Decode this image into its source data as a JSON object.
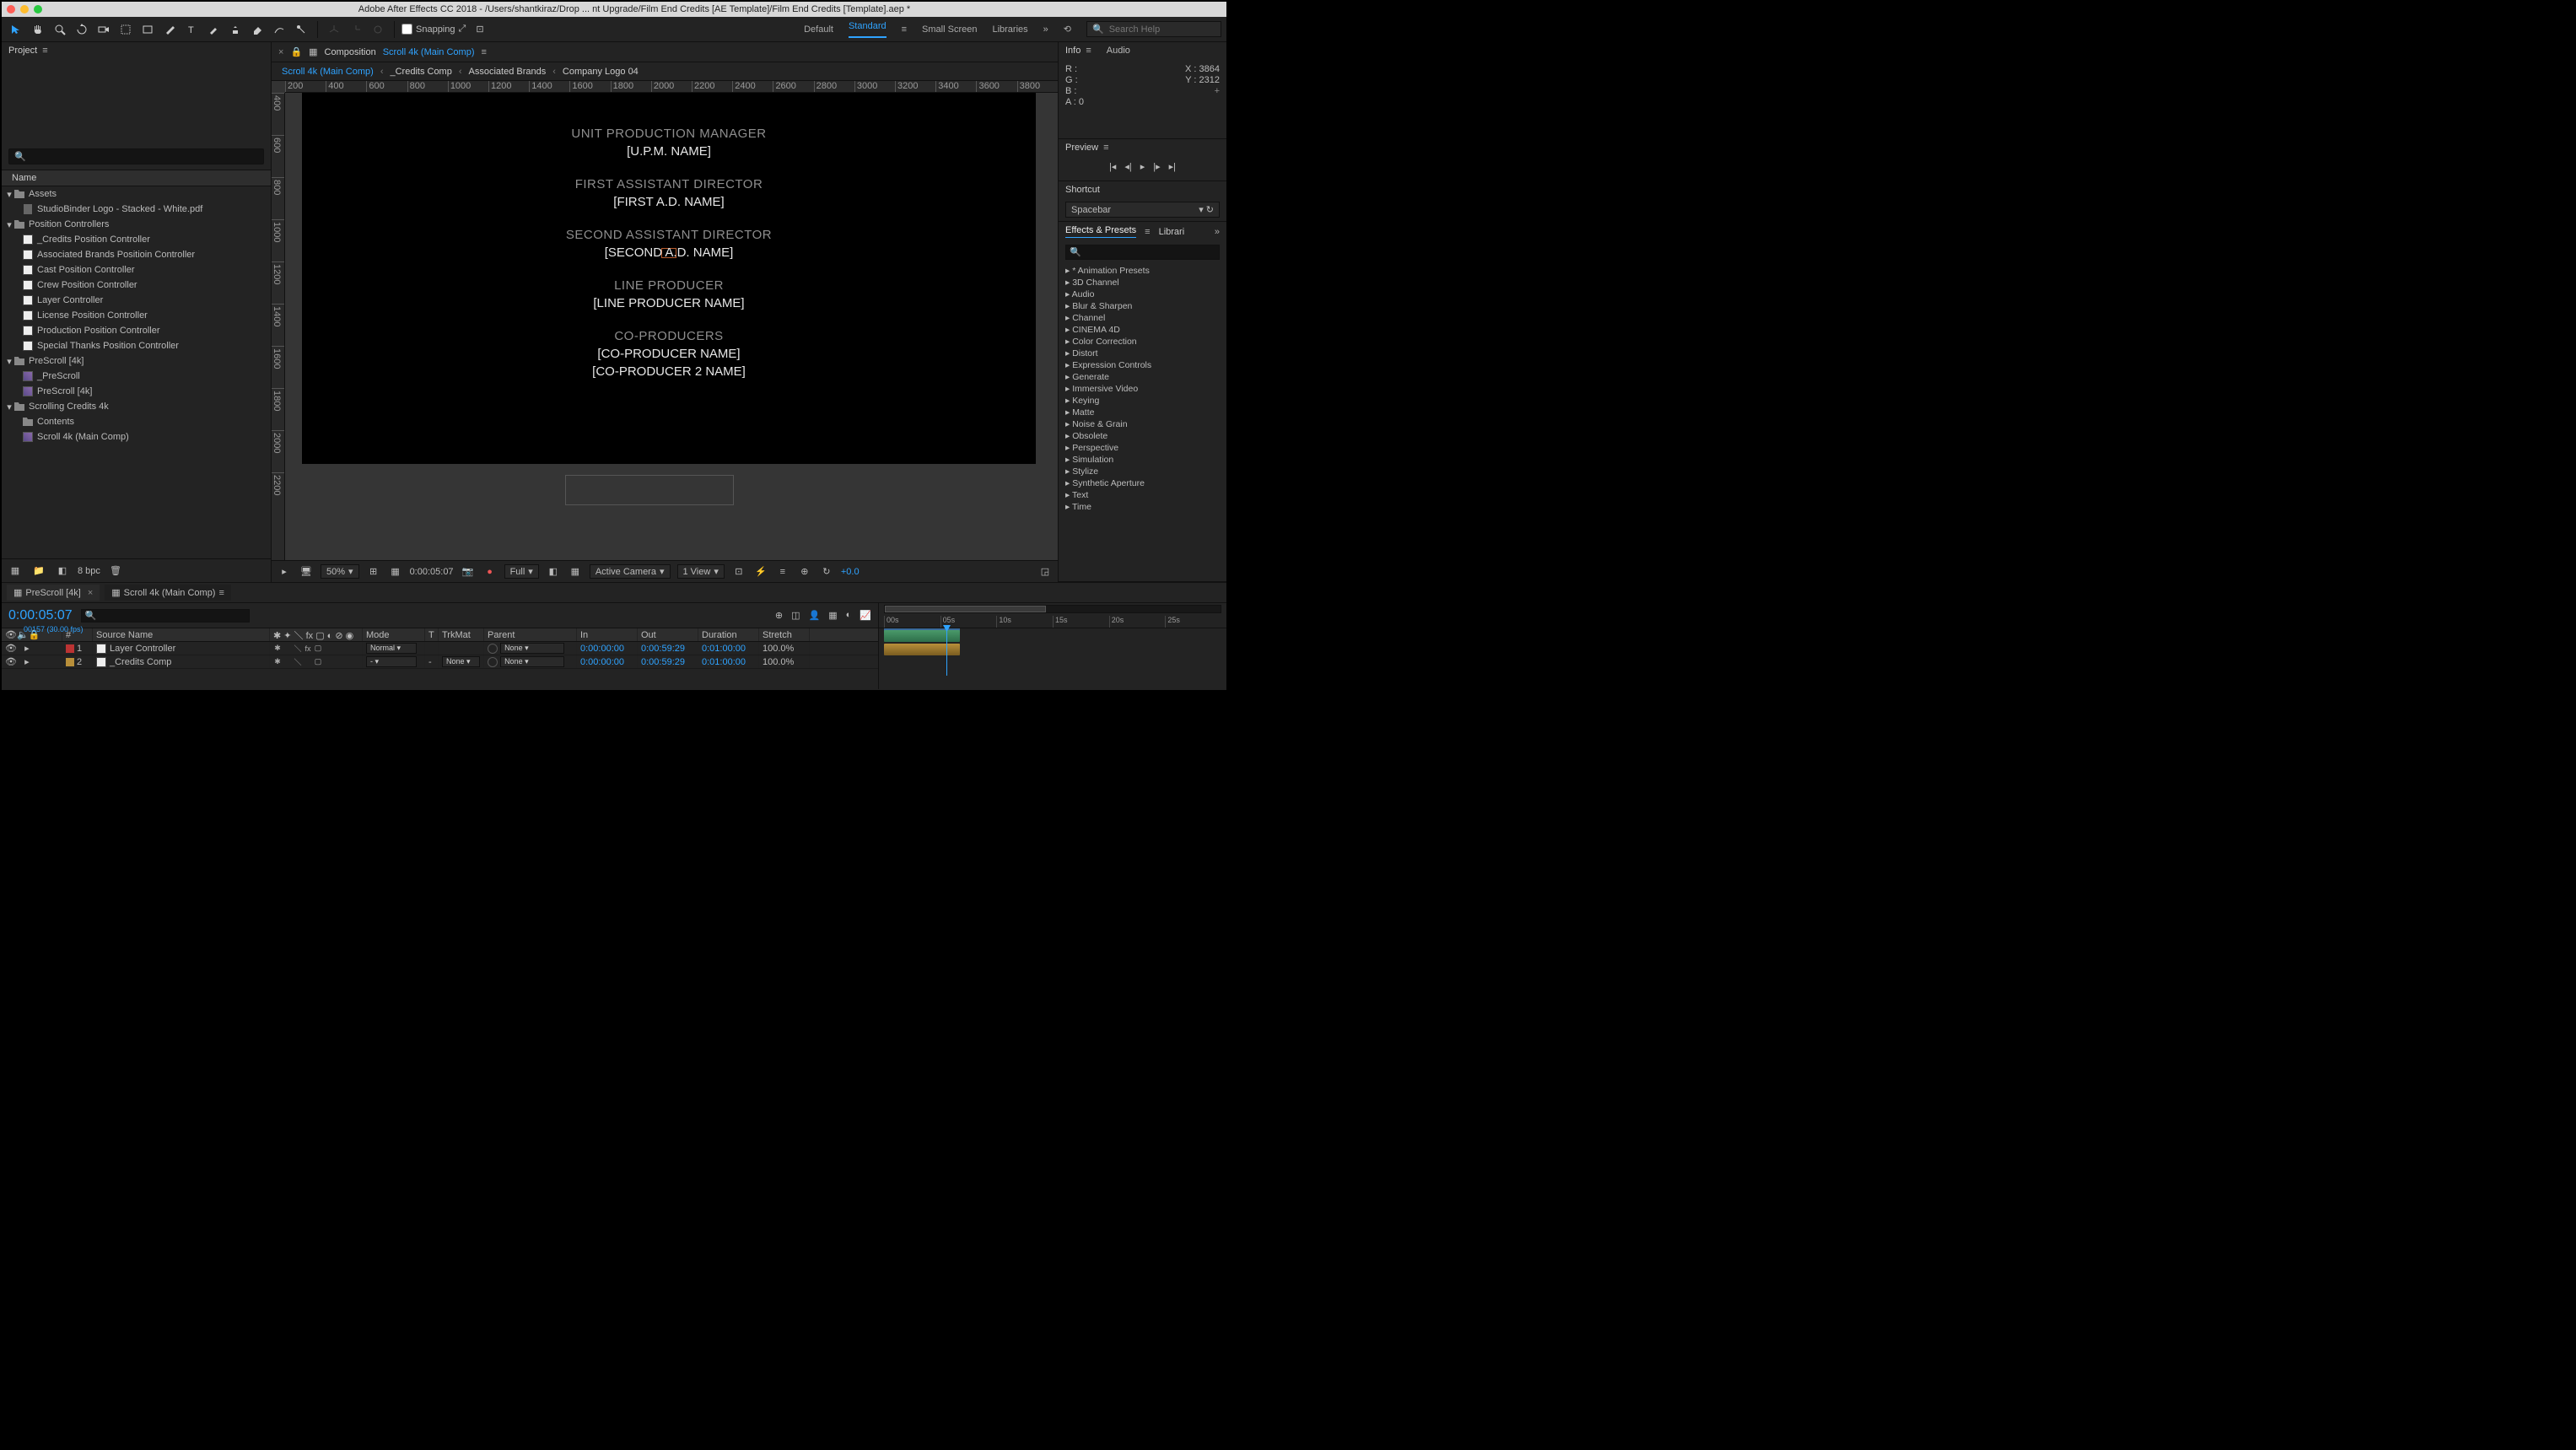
{
  "titlebar": "Adobe After Effects CC 2018 - /Users/shantkiraz/Drop ... nt Upgrade/Film End Credits [AE Template]/Film End Credits [Template].aep *",
  "toolbar": {
    "snapping": "Snapping",
    "workspaces": [
      "Default",
      "Standard",
      "Small Screen",
      "Libraries"
    ],
    "active_workspace": 1,
    "search_placeholder": "Search Help"
  },
  "project_panel": {
    "label": "Project",
    "search_placeholder": "",
    "name_header": "Name",
    "tree": [
      {
        "t": "folder",
        "n": "Assets",
        "open": true,
        "d": 0,
        "children": [
          {
            "t": "file",
            "n": "StudioBinder Logo - Stacked - White.pdf",
            "d": 1
          }
        ]
      },
      {
        "t": "folder",
        "n": "Position Controllers",
        "open": true,
        "d": 0,
        "children": [
          {
            "t": "solid",
            "n": "_Credits Position Controller",
            "d": 1
          },
          {
            "t": "solid",
            "n": "Associated Brands Positioin Controller",
            "d": 1
          },
          {
            "t": "solid",
            "n": "Cast Position Controller",
            "d": 1
          },
          {
            "t": "solid",
            "n": "Crew Position Controller",
            "d": 1
          },
          {
            "t": "solid",
            "n": "Layer Controller",
            "d": 1
          },
          {
            "t": "solid",
            "n": "License Position Controller",
            "d": 1
          },
          {
            "t": "solid",
            "n": "Production Position Controller",
            "d": 1
          },
          {
            "t": "solid",
            "n": "Special Thanks Position Controller",
            "d": 1
          }
        ]
      },
      {
        "t": "folder",
        "n": "PreScroll [4k]",
        "open": true,
        "d": 0,
        "children": [
          {
            "t": "comp",
            "n": "_PreScroll",
            "d": 1
          },
          {
            "t": "comp",
            "n": "PreScroll [4k]",
            "d": 1
          }
        ]
      },
      {
        "t": "folder",
        "n": "Scrolling Credits 4k",
        "open": true,
        "d": 0,
        "children": [
          {
            "t": "folder",
            "n": "Contents",
            "open": false,
            "d": 1
          },
          {
            "t": "comp",
            "n": "Scroll 4k (Main Comp)",
            "d": 1
          }
        ]
      }
    ],
    "footer_bpc": "8 bpc"
  },
  "comp_header": {
    "prefix": "Composition",
    "name": "Scroll 4k (Main Comp)"
  },
  "crumbs": [
    "Scroll 4k (Main Comp)",
    "_Credits Comp",
    "Associated Brands",
    "Company Logo 04"
  ],
  "ruler_h": [
    "200",
    "400",
    "600",
    "800",
    "1000",
    "1200",
    "1400",
    "1600",
    "1800",
    "2000",
    "2200",
    "2400",
    "2600",
    "2800",
    "3000",
    "3200",
    "3400",
    "3600",
    "3800"
  ],
  "ruler_v": [
    "400",
    "600",
    "800",
    "1000",
    "1200",
    "1400",
    "1600",
    "1800",
    "2000",
    "2200"
  ],
  "credits": [
    {
      "role": "UNIT PRODUCTION MANAGER",
      "names": [
        "[U.P.M. NAME]"
      ]
    },
    {
      "role": "FIRST ASSISTANT DIRECTOR",
      "names": [
        "[FIRST A.D. NAME]"
      ]
    },
    {
      "role": "SECOND ASSISTANT DIRECTOR",
      "names": [
        "[SECOND A.D. NAME]"
      ]
    },
    {
      "role": "LINE PRODUCER",
      "names": [
        "[LINE PRODUCER NAME]"
      ]
    },
    {
      "role": "CO-PRODUCERS",
      "names": [
        "[CO-PRODUCER NAME]",
        "[CO-PRODUCER 2 NAME]"
      ]
    }
  ],
  "view_footer": {
    "zoom": "50%",
    "timecode": "0:00:05:07",
    "resolution": "Full",
    "camera": "Active Camera",
    "view": "1 View",
    "exposure": "+0.0"
  },
  "info": {
    "label": "Info",
    "audio_label": "Audio",
    "r": "R :",
    "g": "G :",
    "b": "B :",
    "a": "A :  0",
    "x": "X :  3864",
    "y": "Y :  2312"
  },
  "preview": {
    "label": "Preview"
  },
  "shortcut": {
    "label": "Shortcut",
    "value": "Spacebar"
  },
  "effects": {
    "tab1": "Effects & Presets",
    "tab2": "Librari",
    "items": [
      "* Animation Presets",
      "3D Channel",
      "Audio",
      "Blur & Sharpen",
      "Channel",
      "CINEMA 4D",
      "Color Correction",
      "Distort",
      "Expression Controls",
      "Generate",
      "Immersive Video",
      "Keying",
      "Matte",
      "Noise & Grain",
      "Obsolete",
      "Perspective",
      "Simulation",
      "Stylize",
      "Synthetic Aperture",
      "Text",
      "Time"
    ]
  },
  "timeline": {
    "tabs": [
      "PreScroll [4k]",
      "Scroll 4k (Main Comp)"
    ],
    "active_tab": 1,
    "timecode": "0:00:05:07",
    "frames_label": "00157 (30.00 fps)",
    "col_headers": {
      "num": "#",
      "src": "Source Name",
      "mode": "Mode",
      "t": "T",
      "trkmat": "TrkMat",
      "parent": "Parent",
      "in": "In",
      "out": "Out",
      "dur": "Duration",
      "str": "Stretch"
    },
    "layers": [
      {
        "num": "1",
        "tag": "red",
        "name": "Layer Controller",
        "mode": "Normal",
        "trk": "",
        "parent": "None",
        "in": "0:00:00:00",
        "out": "0:00:59:29",
        "dur": "0:01:00:00",
        "str": "100.0%",
        "fx": true
      },
      {
        "num": "2",
        "tag": "yel",
        "name": "_Credits Comp",
        "mode": "-",
        "trk": "None",
        "parent": "None",
        "in": "0:00:00:00",
        "out": "0:00:59:29",
        "dur": "0:01:00:00",
        "str": "100.0%",
        "fx": false
      }
    ],
    "ruler": [
      "00s",
      "05s",
      "10s",
      "15s",
      "20s",
      "25s"
    ]
  }
}
